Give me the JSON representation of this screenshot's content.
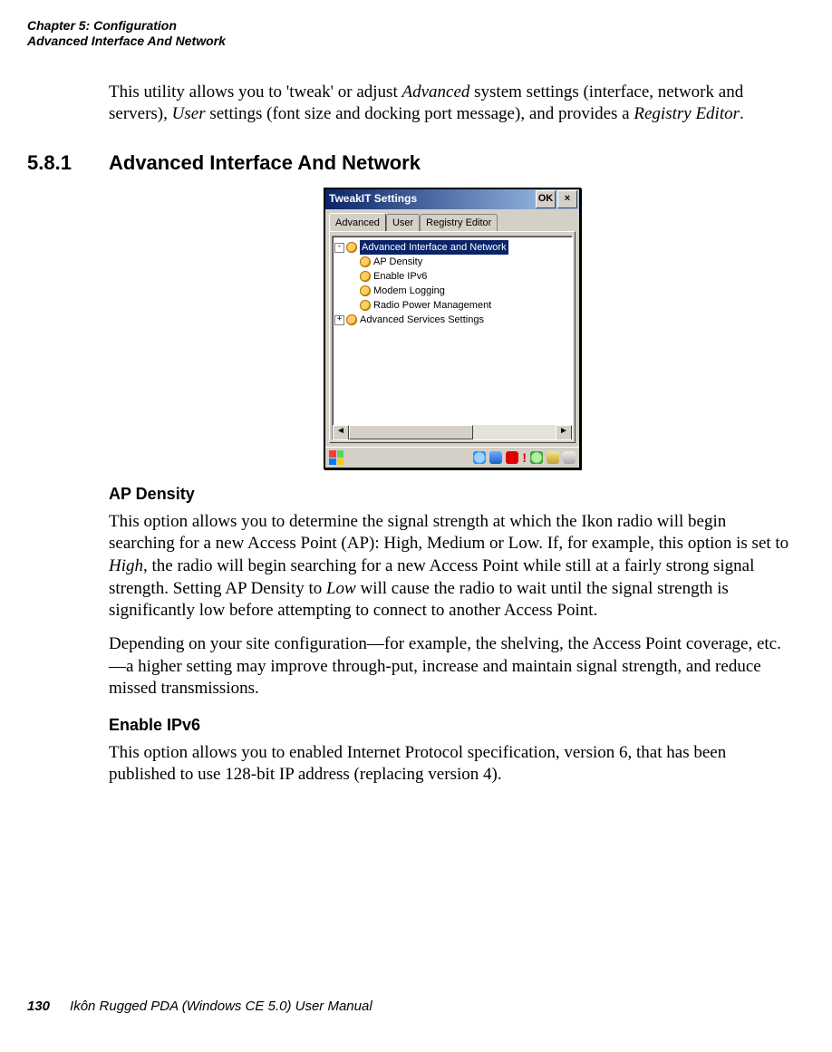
{
  "header": {
    "line1": "Chapter 5: Configuration",
    "line2": "Advanced Interface And Network"
  },
  "intro": {
    "p1a": "This utility allows you to 'tweak' or adjust ",
    "p1_adv": "Advanced",
    "p1b": " system settings (interface, network and servers), ",
    "p1_user": "User",
    "p1c": " settings (font size and docking port message), and provides a ",
    "p1_reg": "Registry Editor",
    "p1d": "."
  },
  "section": {
    "num": "5.8.1",
    "title": "Advanced Interface And Network"
  },
  "dialog": {
    "title": "TweakIT Settings",
    "ok": "OK",
    "close": "×",
    "tabs": {
      "advanced": "Advanced",
      "user": "User",
      "reg": "Registry Editor"
    },
    "tree": {
      "n1": "Advanced Interface and Network",
      "n1a": "AP Density",
      "n1b": "Enable IPv6",
      "n1c": "Modem Logging",
      "n1d": "Radio Power Management",
      "n2": "Advanced Services Settings"
    },
    "scroll": {
      "left": "◄",
      "right": "►"
    },
    "tray_excl": "!"
  },
  "ap": {
    "heading": "AP Density",
    "p1a": "This option allows you to determine the signal strength at which the Ikon radio will begin searching for a new Access Point (AP): High, Medium or Low. If, for example, this option is set to ",
    "p1_high": "High",
    "p1b": ", the radio will begin searching for a new Access Point while still at a fairly strong signal strength. Setting AP Density to ",
    "p1_low": "Low",
    "p1c": " will cause the radio to wait until the signal strength is significantly low before attempting to connect to another Access Point.",
    "p2": "Depending on your site configuration—for example, the shelving, the Access Point coverage, etc.—a higher setting may improve through-put, increase and maintain signal strength, and reduce missed transmissions."
  },
  "ipv6": {
    "heading": "Enable IPv6",
    "p1": "This option allows you to enabled Internet Protocol specification, version 6, that has been published to use 128-bit IP address (replacing version 4)."
  },
  "footer": {
    "page": "130",
    "title": "Ikôn Rugged PDA (Windows CE 5.0) User Manual"
  }
}
